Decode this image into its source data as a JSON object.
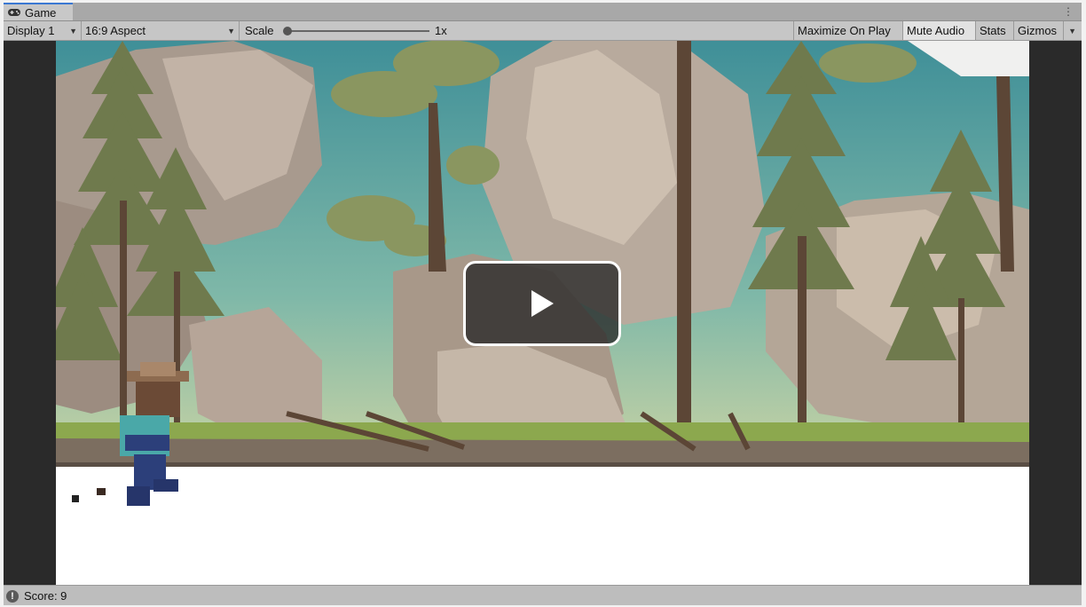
{
  "tab": {
    "label": "Game",
    "icon": "gamepad-icon",
    "menu_icon": "kebab-menu-icon"
  },
  "toolbar": {
    "display": "Display 1",
    "aspect": "16:9 Aspect",
    "scale_label": "Scale",
    "scale_value": "1x",
    "scale_level": 0,
    "maximize": "Maximize On Play",
    "mute": "Mute Audio",
    "mute_active": true,
    "stats": "Stats",
    "gizmos": "Gizmos"
  },
  "game": {
    "play_icon": "play-icon",
    "ground_color": "#ffffff",
    "sky_color": "#5fa3a6"
  },
  "status": {
    "icon": "info-icon",
    "text": "Score: 9"
  }
}
